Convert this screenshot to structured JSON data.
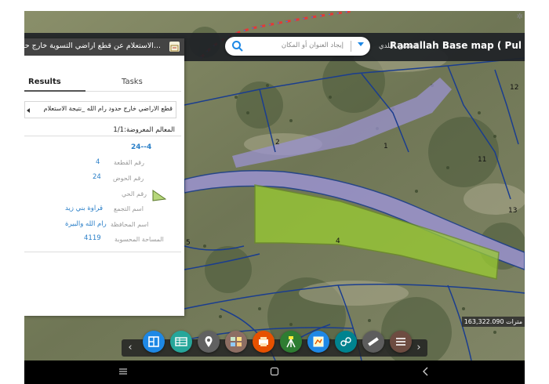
{
  "app": {
    "title": "Ramallah Base map ( Pul",
    "municipal_label": "المصفح البلدي",
    "search": {
      "placeholder": "إيجاد العنوان أو المكان"
    }
  },
  "panel": {
    "header_title": "الاستعلام عن قطع اراضي التسوية خارج حدو...",
    "tabs": [
      {
        "label": "Results"
      },
      {
        "label": "Tasks"
      }
    ],
    "active_tab": "Results",
    "dropdown_value": "قطع الاراضي خارج حدود رام الله _نتيجة الاستعلام",
    "shown_features": "المعالم المعروضة:1/1",
    "record": {
      "title": "24--4",
      "fields": [
        {
          "label": "رقم القطعة",
          "value": "4"
        },
        {
          "label": "رقم الحوض",
          "value": "24"
        },
        {
          "label": "رقم الحي",
          "value": ""
        },
        {
          "label": "اسم التجمع",
          "value": "قراوة بني زيد"
        },
        {
          "label": "اسم المحافظة",
          "value": "رام الله والبيرة"
        },
        {
          "label": "المساحة المحسوبة",
          "value": "4119"
        }
      ]
    }
  },
  "map": {
    "parcel_labels": [
      "2",
      "1",
      "11",
      "12",
      "13",
      "4",
      "5"
    ],
    "scale": "163,322.090 مترات"
  },
  "toolbar": {
    "buttons": [
      {
        "name": "layers-icon",
        "color": "#1e88e5"
      },
      {
        "name": "table-icon",
        "color": "#26a69a"
      },
      {
        "name": "location-pin-icon",
        "color": "#616161"
      },
      {
        "name": "basemap-gallery-icon",
        "color": "#8d6e63"
      },
      {
        "name": "print-icon",
        "color": "#e65100"
      },
      {
        "name": "survey-tripod-icon",
        "color": "#2e7d32"
      },
      {
        "name": "map-document-icon",
        "color": "#1e88e5"
      },
      {
        "name": "query-icon",
        "color": "#00838f"
      },
      {
        "name": "measure-icon",
        "color": "#5d5d5d"
      },
      {
        "name": "list-menu-icon",
        "color": "#6d4c41"
      }
    ]
  },
  "colors": {
    "accent": "#2a7fc8",
    "parcel_highlight": "#9acd32",
    "road": "#9b93d0"
  }
}
